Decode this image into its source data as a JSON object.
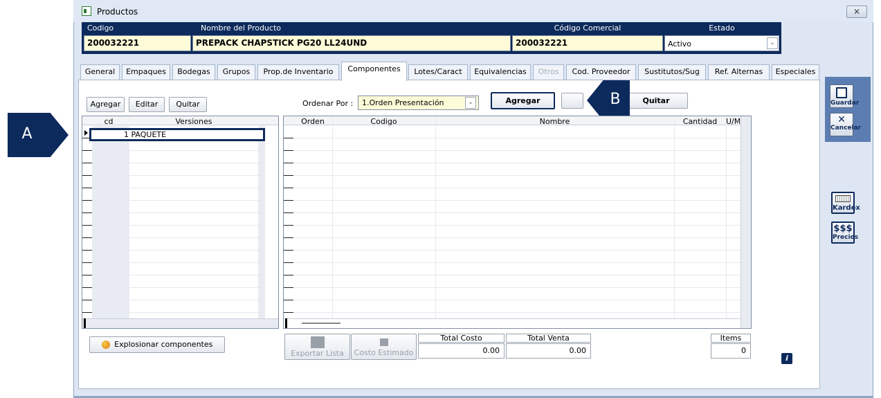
{
  "window": {
    "title": "Productos",
    "close_label": "✕"
  },
  "header": {
    "codigo_label": "Codigo",
    "nombre_label": "Nombre del Producto",
    "comercial_label": "Código Comercial",
    "estado_label": "Estado",
    "codigo": "200032221",
    "nombre": "PREPACK CHAPSTICK PG20 LL24UND",
    "comercial": "200032221",
    "estado": "Activo"
  },
  "tabs": [
    "General",
    "Empaques",
    "Bodegas",
    "Grupos",
    "Prop.de Inventario",
    "Componentes",
    "Lotes/Caract",
    "Equivalencias",
    "Otros",
    "Cod. Proveedor",
    "Sustitutos/Sug",
    "Ref. Alternas",
    "Especiales"
  ],
  "left_toolbar": {
    "agregar": "Agregar",
    "editar": "Editar",
    "quitar": "Quitar"
  },
  "order": {
    "label": "Ordenar Por :",
    "value": "1.Orden Presentación"
  },
  "right_toolbar": {
    "agregar": "Agregar",
    "quitar": "Quitar"
  },
  "versions_grid": {
    "headers": [
      "cd",
      "Versiones"
    ],
    "rows": [
      {
        "text": "1 PAQUETE"
      }
    ]
  },
  "components_grid": {
    "headers": [
      "Orden",
      "Codigo",
      "Nombre",
      "Cantidad",
      "U/M"
    ]
  },
  "bottom": {
    "explosionar": "Explosionar componentes",
    "exportar": "Exportar Lista",
    "costo_estimado": "Costo Estimado",
    "total_costo_label": "Total Costo",
    "total_costo": "0.00",
    "total_venta_label": "Total Venta",
    "total_venta": "0.00",
    "items_label": "Items",
    "items": "0"
  },
  "side": {
    "guardar": "Guardar",
    "cancelar": "Cancelar",
    "kardex": "Kardex",
    "precios_symbol": "$$$",
    "precios": "Precios"
  },
  "callouts": {
    "a": "A",
    "b": "B"
  },
  "colors": {
    "navy": "#0d2a5c",
    "field_yellow": "#fefbd8",
    "window_bg": "#dde6f2"
  }
}
